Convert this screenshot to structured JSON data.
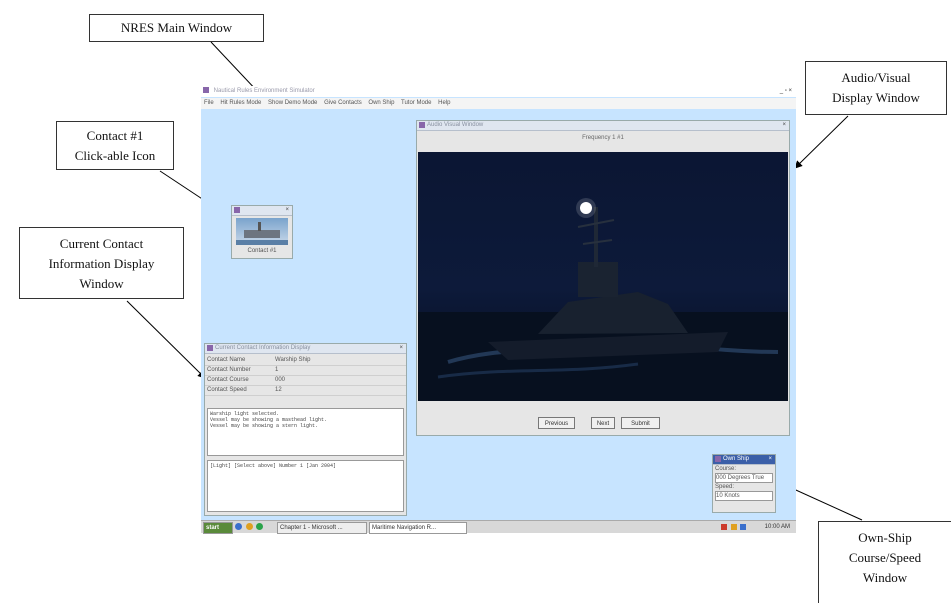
{
  "callouts": {
    "nres": "NRES Main Window",
    "av_line1": "Audio/Visual",
    "av_line2": "Display Window",
    "contact_line1": "Contact #1",
    "contact_line2": "Click-able Icon",
    "info_line1": "Current Contact",
    "info_line2": "Information Display",
    "info_line3": "Window",
    "own_line1": "Own-Ship",
    "own_line2": "Course/Speed",
    "own_line3": "Window"
  },
  "main_window": {
    "title": "Nautical Rules Environment Simulator",
    "window_controls": "_ ▫ ×",
    "menu": [
      "File",
      "Hit Rules Mode",
      "Show Demo Mode",
      "Give Contacts",
      "Own Ship",
      "Tutor Mode",
      "Help"
    ]
  },
  "contact_icon": {
    "label": "Contact #1"
  },
  "av_window": {
    "title": "Audio Visual Window",
    "caption": "Frequency 1 #1",
    "buttons": {
      "previous": "Previous",
      "next": "Next",
      "submit": "Submit"
    }
  },
  "info_window": {
    "title": "Current Contact Information Display",
    "fields": [
      {
        "label": "Contact Name",
        "value": "Warship Ship"
      },
      {
        "label": "Contact Number",
        "value": "1"
      },
      {
        "label": "Contact Course",
        "value": "000"
      },
      {
        "label": "Contact Speed",
        "value": "12"
      }
    ],
    "log_lines": [
      "Warship light selected.",
      "Vessel may be showing a masthead light.",
      "Vessel may be showing a stern light."
    ],
    "status_line": "[Light] [Select above]  Number 1  [Jan 2004]"
  },
  "ownship_window": {
    "title": "Own Ship",
    "course_label": "Course:",
    "course_value": "000 Degrees True",
    "speed_label": "Speed:",
    "speed_value": "10 Knots"
  },
  "taskbar": {
    "start": "start",
    "task1": "Chapter 1 - Microsoft ...",
    "task2": "Maritime Navigation R...",
    "clock": "10:00 AM"
  },
  "colors": {
    "desktop": "#c7e4ff",
    "night_sky": "#0a1430",
    "light": "#ffffff"
  }
}
